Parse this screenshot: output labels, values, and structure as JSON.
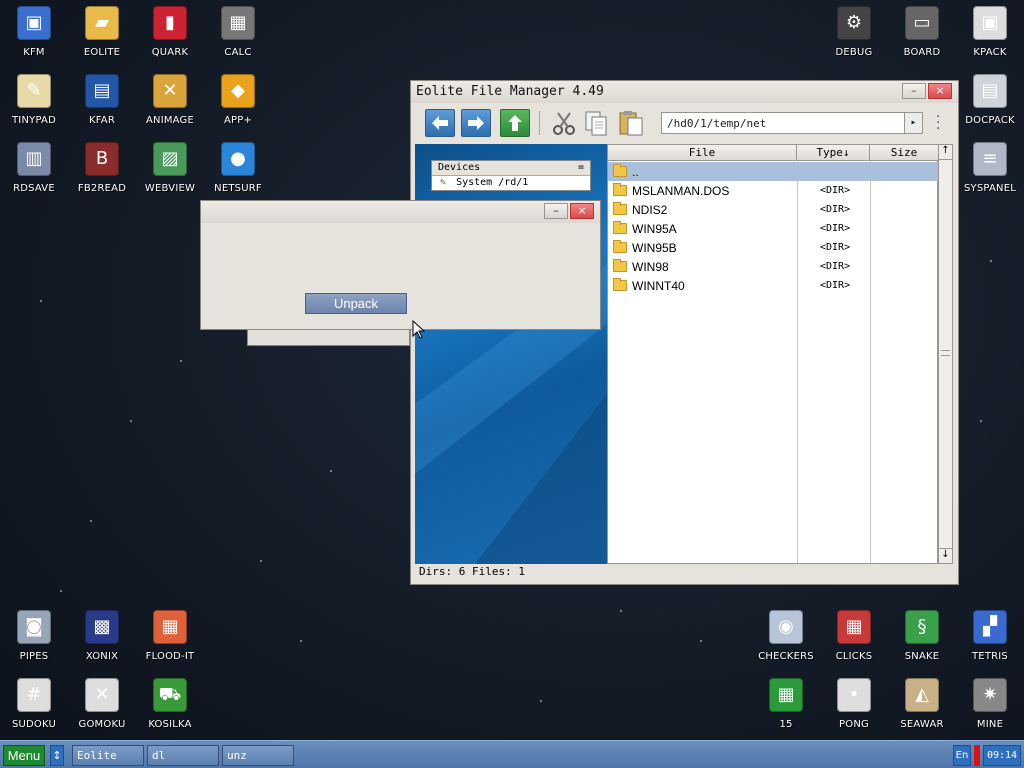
{
  "desktop_icons": [
    {
      "label": "KFM",
      "icon": "floppy-disk-icon"
    },
    {
      "label": "EOLITE",
      "icon": "folder-icon"
    },
    {
      "label": "QUARK",
      "icon": "notebook-icon"
    },
    {
      "label": "CALC",
      "icon": "calculator-icon"
    },
    {
      "label": "TINYPAD",
      "icon": "notepad-icon"
    },
    {
      "label": "KFAR",
      "icon": "archive-icon"
    },
    {
      "label": "ANIMAGE",
      "icon": "paint-tools-icon"
    },
    {
      "label": "APP+",
      "icon": "rubiks-cube-icon"
    },
    {
      "label": "RDSAVE",
      "icon": "save-disk-icon"
    },
    {
      "label": "FB2READ",
      "icon": "book-icon"
    },
    {
      "label": "WEBVIEW",
      "icon": "web-page-icon"
    },
    {
      "label": "NETSURF",
      "icon": "globe-icon"
    },
    {
      "label": "DEBUG",
      "icon": "debug-icon"
    },
    {
      "label": "BOARD",
      "icon": "board-icon"
    },
    {
      "label": "KPACK",
      "icon": "package-icon"
    },
    {
      "label": "DOCPACK",
      "icon": "cabinet-icon"
    },
    {
      "label": "SYSPANEL",
      "icon": "sliders-icon"
    },
    {
      "label": "PIPES",
      "icon": "pipes-icon"
    },
    {
      "label": "XONIX",
      "icon": "xonix-icon"
    },
    {
      "label": "FLOOD-IT",
      "icon": "color-grid-icon"
    },
    {
      "label": "SUDOKU",
      "icon": "sudoku-icon"
    },
    {
      "label": "GOMOKU",
      "icon": "gomoku-icon"
    },
    {
      "label": "KOSILKA",
      "icon": "lawnmower-icon"
    },
    {
      "label": "CHECKERS",
      "icon": "checkers-icon"
    },
    {
      "label": "CLICKS",
      "icon": "clicks-icon"
    },
    {
      "label": "SNAKE",
      "icon": "snake-icon"
    },
    {
      "label": "TETRIS",
      "icon": "tetris-icon"
    },
    {
      "label": "15",
      "icon": "fifteen-puzzle-icon"
    },
    {
      "label": "PONG",
      "icon": "pong-icon"
    },
    {
      "label": "SEAWAR",
      "icon": "seawar-icon"
    },
    {
      "label": "MINE",
      "icon": "mine-icon"
    }
  ],
  "file_manager": {
    "title": "Eolite File Manager 4.49",
    "path": "/hd0/1/temp/net",
    "devices_header": "Devices",
    "devices_menu": "=",
    "devices": [
      "System /rd/1"
    ],
    "columns": {
      "file": "File",
      "type": "Type↓",
      "size": "Size"
    },
    "parent_entry": "..",
    "rows": [
      {
        "name": "MSLANMAN.DOS",
        "type": "<DIR>"
      },
      {
        "name": "NDIS2",
        "type": "<DIR>"
      },
      {
        "name": "WIN95A",
        "type": "<DIR>"
      },
      {
        "name": "WIN95B",
        "type": "<DIR>"
      },
      {
        "name": "WIN98",
        "type": "<DIR>"
      },
      {
        "name": "WINNT40",
        "type": "<DIR>"
      }
    ],
    "status": "Dirs: 6  Files: 1"
  },
  "dialog": {
    "unpack_label": "Unpack"
  },
  "taskbar": {
    "menu_label": "Menu",
    "tasks": [
      "Eolite",
      "dl",
      "unz"
    ],
    "lang": "En",
    "clock": "09:14"
  },
  "colors": {
    "accent": "#4f76a8",
    "menu_green": "#1e8a2e",
    "selection": "#a9bfdc"
  }
}
